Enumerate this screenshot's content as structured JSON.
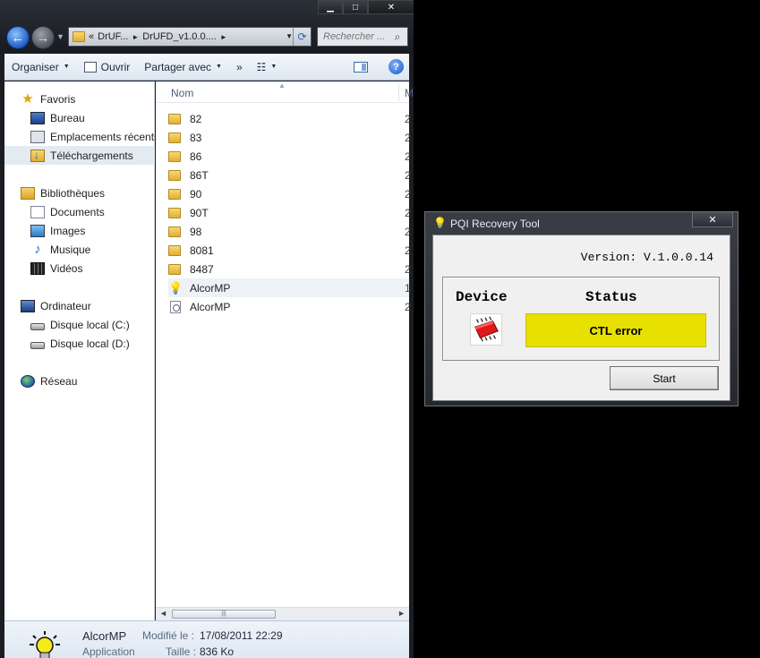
{
  "explorer": {
    "address": {
      "overflow": "«",
      "segments": [
        "DrUF...",
        "DrUFD_v1.0.0...."
      ],
      "search_placeholder": "Rechercher ..."
    },
    "toolbar": {
      "organize": "Organiser",
      "open": "Ouvrir",
      "share": "Partager avec",
      "more": "»"
    },
    "nav": {
      "favorites": "Favoris",
      "desktop": "Bureau",
      "recent_places": "Emplacements récents",
      "downloads": "Téléchargements",
      "libraries": "Bibliothèques",
      "documents": "Documents",
      "images": "Images",
      "music": "Musique",
      "videos": "Vidéos",
      "computer": "Ordinateur",
      "disk_c": "Disque local (C:)",
      "disk_d": "Disque local (D:)",
      "network": "Réseau"
    },
    "columns": {
      "name": "Nom",
      "next": "M"
    },
    "files": [
      {
        "name": "82",
        "type": "folder",
        "trunc": "2"
      },
      {
        "name": "83",
        "type": "folder",
        "trunc": "2"
      },
      {
        "name": "86",
        "type": "folder",
        "trunc": "2"
      },
      {
        "name": "86T",
        "type": "folder",
        "trunc": "2"
      },
      {
        "name": "90",
        "type": "folder",
        "trunc": "2"
      },
      {
        "name": "90T",
        "type": "folder",
        "trunc": "2"
      },
      {
        "name": "98",
        "type": "folder",
        "trunc": "2"
      },
      {
        "name": "8081",
        "type": "folder",
        "trunc": "2"
      },
      {
        "name": "8487",
        "type": "folder",
        "trunc": "2"
      },
      {
        "name": "AlcorMP",
        "type": "application",
        "trunc": "1"
      },
      {
        "name": "AlcorMP",
        "type": "config",
        "trunc": "2"
      }
    ],
    "details": {
      "name": "AlcorMP",
      "type": "Application",
      "modified_label": "Modifié le :",
      "modified_value": "17/08/2011 22:29",
      "size_label": "Taille :",
      "size_value": "836 Ko"
    }
  },
  "pqi": {
    "title": "PQI Recovery Tool",
    "version": "Version: V.1.0.0.14",
    "device_label": "Device",
    "status_label": "Status",
    "status_text": "CTL error",
    "status_color": "#e8e000",
    "start_label": "Start"
  }
}
